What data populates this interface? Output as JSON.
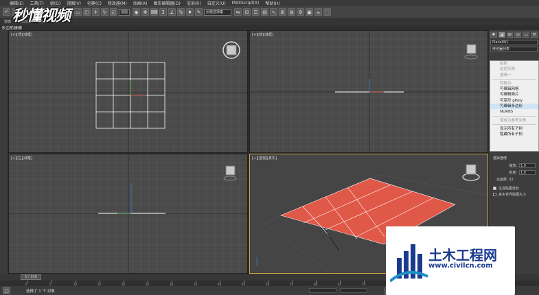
{
  "menubar": {
    "items": [
      "编辑(E)",
      "工具(T)",
      "组(G)",
      "视图(V)",
      "创建(C)",
      "修改器(M)",
      "动画(A)",
      "图形编辑器(D)",
      "渲染(R)",
      "自定义(U)",
      "MAXScript(X)",
      "帮助(H)"
    ]
  },
  "toolbar": {
    "view_select": "视图",
    "selection_set": "创建选择集"
  },
  "ribbon": {
    "tabs": [
      "建模",
      "自由形式",
      "选择",
      "填充"
    ]
  },
  "subtitle": "多边形建模",
  "viewports": {
    "top": "[+][顶][线框]",
    "front": "[+][前][线框]",
    "left": "[+][左][线框]",
    "perspective": "[+][透视][真实]"
  },
  "command_panel": {
    "object_name": "Plane001",
    "modifier_list": "修改器列表"
  },
  "context_menu": {
    "items": [
      {
        "label": "粘贴",
        "disabled": true
      },
      {
        "label": "粘贴实例",
        "disabled": true
      },
      {
        "label": "使唯一",
        "disabled": true
      },
      {
        "label": "",
        "separator": true
      },
      {
        "label": "转换为:",
        "disabled": true
      },
      {
        "label": "可编辑网格",
        "disabled": false
      },
      {
        "label": "可编辑面片",
        "disabled": false
      },
      {
        "label": "可变形 gPoly",
        "disabled": false
      },
      {
        "label": "可编辑多边形",
        "disabled": false,
        "selected": true
      },
      {
        "label": "NURBS",
        "disabled": false
      },
      {
        "label": "",
        "separator": true
      },
      {
        "label": "使成为参考对象",
        "disabled": true
      },
      {
        "label": "",
        "separator": true
      },
      {
        "label": "显示所有子树",
        "disabled": false
      },
      {
        "label": "隐藏所有子树",
        "disabled": false
      }
    ]
  },
  "render_section": {
    "title": "渲染倍增",
    "scale_label": "缩放:",
    "scale_value": "1.0",
    "density_label": "密度:",
    "density_value": "1.0",
    "total_faces": "总面数: 32",
    "gen_mapping": "生成贴图坐标",
    "real_world": "真实世界贴图大小"
  },
  "timeline": {
    "slider": "0 / 100",
    "ticks": [
      "0",
      "5",
      "10",
      "15",
      "20",
      "25",
      "30",
      "35",
      "40",
      "45",
      "50",
      "55",
      "60",
      "65",
      "70",
      "75",
      "80",
      "85",
      "90",
      "95",
      "100"
    ]
  },
  "status": {
    "text": "选择了 1 个 对象",
    "x": "",
    "y": ""
  },
  "watermark": {
    "top_text": "秒懂视频",
    "logo_title": "土木工程网",
    "logo_url": "www.civilcn.com"
  },
  "colors": {
    "plane": "#e05848",
    "selected_border": "#c9a640",
    "viewport_bg": "#4a4a4a",
    "logo_blue": "#1a3a8f"
  }
}
